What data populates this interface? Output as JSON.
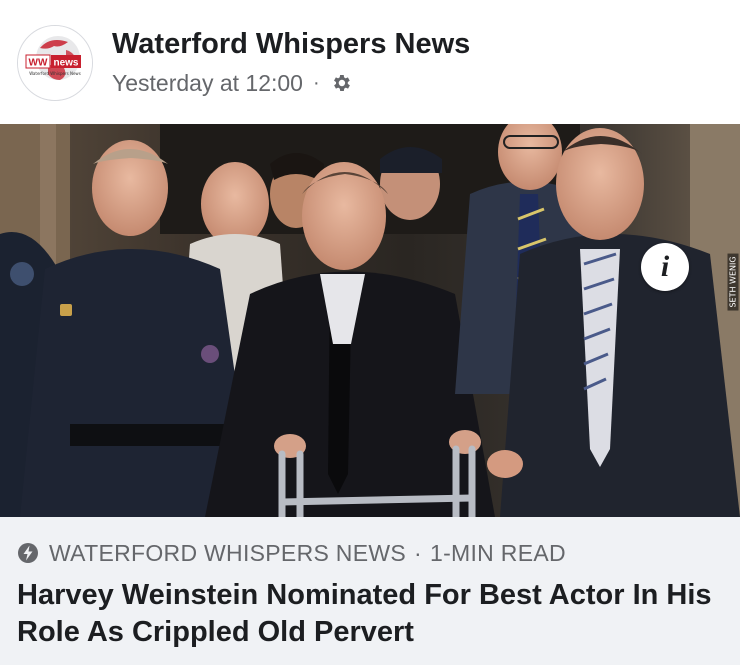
{
  "post": {
    "page_name": "Waterford Whispers News",
    "timestamp": "Yesterday at 12:00",
    "separator": "·",
    "audience_icon": "gear-icon"
  },
  "avatar": {
    "logo_left_text": "WW",
    "logo_right_text": "news",
    "logo_caption": "Waterford Whispers News",
    "brand_red": "#c8202f"
  },
  "photo": {
    "info_label": "i",
    "credit": "SETH WENIG"
  },
  "link_preview": {
    "icon": "bolt-icon",
    "source": "WATERFORD WHISPERS NEWS",
    "separator": "·",
    "read_time": "1-MIN READ",
    "headline": "Harvey Weinstein Nominated For Best Actor In His Role As Crippled Old Pervert"
  },
  "colors": {
    "text_primary": "#1c1e21",
    "text_secondary": "#65676b",
    "card_background": "#f0f2f5"
  }
}
